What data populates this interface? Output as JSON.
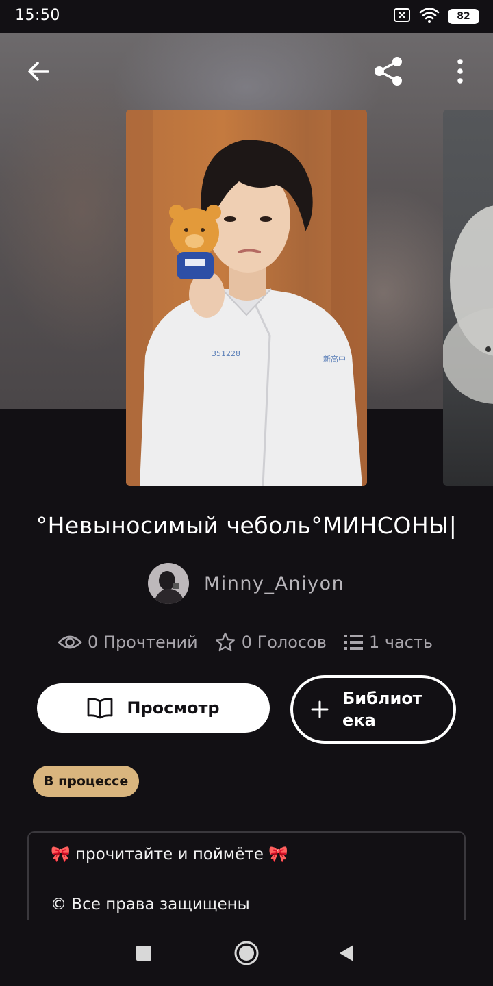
{
  "status_bar": {
    "time": "15:50",
    "battery": "82",
    "icons": [
      "sim-off-icon",
      "wifi-icon",
      "battery-icon"
    ]
  },
  "header": {
    "back_icon": "arrow-left-icon",
    "share_icon": "share-icon",
    "more_icon": "more-vertical-icon"
  },
  "book": {
    "title": "°Невыносимый чеболь°МИНСОНЫ|",
    "author": "Minny_Aniyon",
    "stats": {
      "reads": "0 Прочтений",
      "votes": "0 Голосов",
      "parts": "1 часть"
    },
    "status": "В процессе"
  },
  "actions": {
    "view_label": "Просмотр",
    "library_label": "Библиотека"
  },
  "description": {
    "line1": "🎀 прочитайте и  поймёте 🎀",
    "line2": "© Все права защищены"
  },
  "nav": {
    "icons": [
      "recent-apps-icon",
      "home-icon",
      "back-icon"
    ]
  },
  "colors": {
    "background": "#121014",
    "badge": "#d9b57e",
    "muted_text": "#a9a6ac"
  }
}
